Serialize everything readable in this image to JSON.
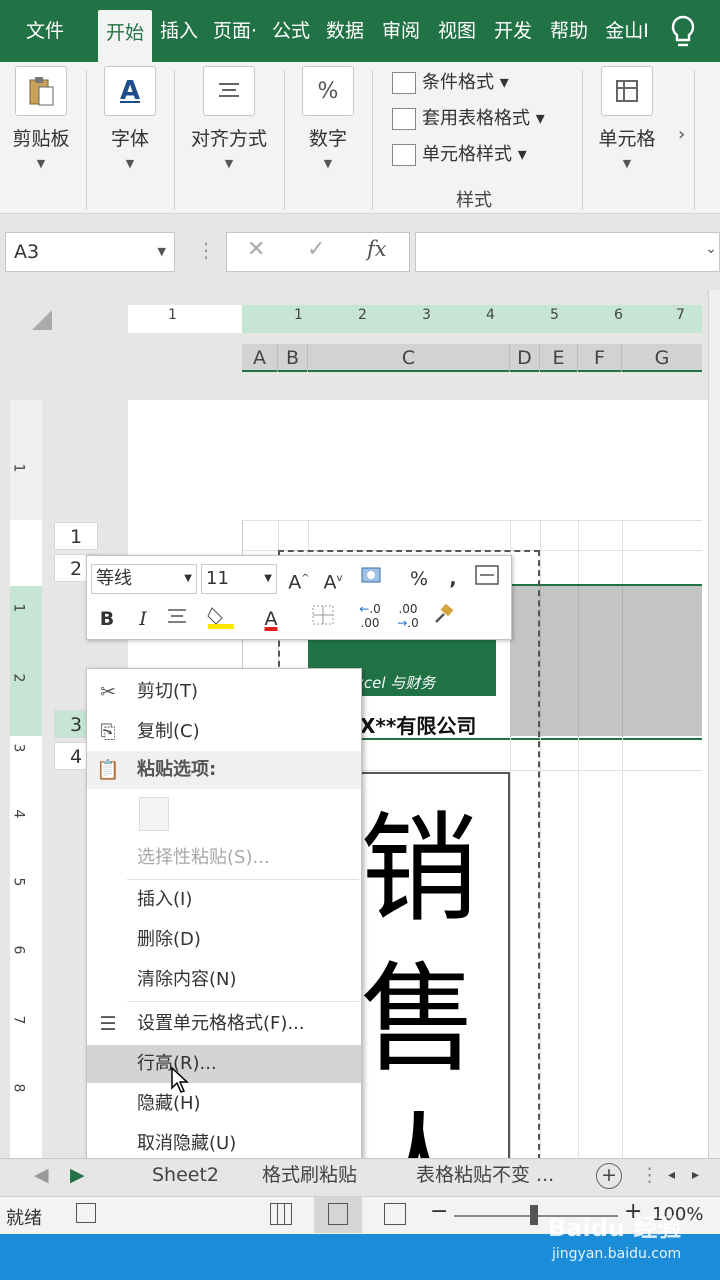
{
  "tabs": [
    "文件",
    "开始",
    "插入",
    "页面·",
    "公式",
    "数据",
    "审阅",
    "视图",
    "开发",
    "帮助",
    "金山I"
  ],
  "active_tab": "开始",
  "ribbon": {
    "clipboard": "剪贴板",
    "font": "字体",
    "font_icon": "A",
    "align": "对齐方式",
    "number": "数字",
    "number_icon": "%",
    "cond_format": "条件格式",
    "table_format": "套用表格格式",
    "cell_style": "单元格样式",
    "styles_group": "样式",
    "cells": "单元格",
    "more": "›"
  },
  "formula": {
    "namebox": "A3",
    "cancel": "✕",
    "enter": "✓",
    "fx": "fx",
    "value": ""
  },
  "ruler_h": [
    "1",
    "1",
    "2",
    "3",
    "4",
    "5",
    "6",
    "7"
  ],
  "ruler_v": [
    "1",
    "1",
    "2",
    "3",
    "4",
    "5",
    "6",
    "7",
    "8"
  ],
  "columns": [
    "A",
    "B",
    "C",
    "D",
    "E",
    "F",
    "G"
  ],
  "rows": [
    "1",
    "2",
    "3",
    "4"
  ],
  "sheet": {
    "logo_caption": "xcel 与财务",
    "company": "X**有限公司",
    "big_chars": [
      "销",
      "售",
      "人"
    ]
  },
  "mini_toolbar": {
    "font_name": "等线",
    "font_size": "11",
    "grow": "A",
    "shrink": "A",
    "percent": "%",
    "comma": ",",
    "bold": "B",
    "italic": "I",
    "font_color_icon": "A",
    "inc_decimal": ".00",
    "dec_decimal": ".00"
  },
  "context_menu": {
    "cut": "剪切(T)",
    "copy": "复制(C)",
    "paste_options": "粘贴选项:",
    "paste_special": "选择性粘贴(S)...",
    "insert": "插入(I)",
    "delete": "删除(D)",
    "clear": "清除内容(N)",
    "format_cells": "设置单元格格式(F)...",
    "row_height": "行高(R)...",
    "hide": "隐藏(H)",
    "unhide": "取消隐藏(U)"
  },
  "sheet_tabs": [
    "Sheet2",
    "格式刷粘贴",
    "表格粘贴不变 ..."
  ],
  "status": {
    "ready": "就绪",
    "zoom": "100%"
  },
  "watermark": {
    "main": "Baidu 经验",
    "url": "jingyan.baidu.com"
  },
  "colors": {
    "accent": "#217346",
    "blue": "#1a8cd8"
  }
}
